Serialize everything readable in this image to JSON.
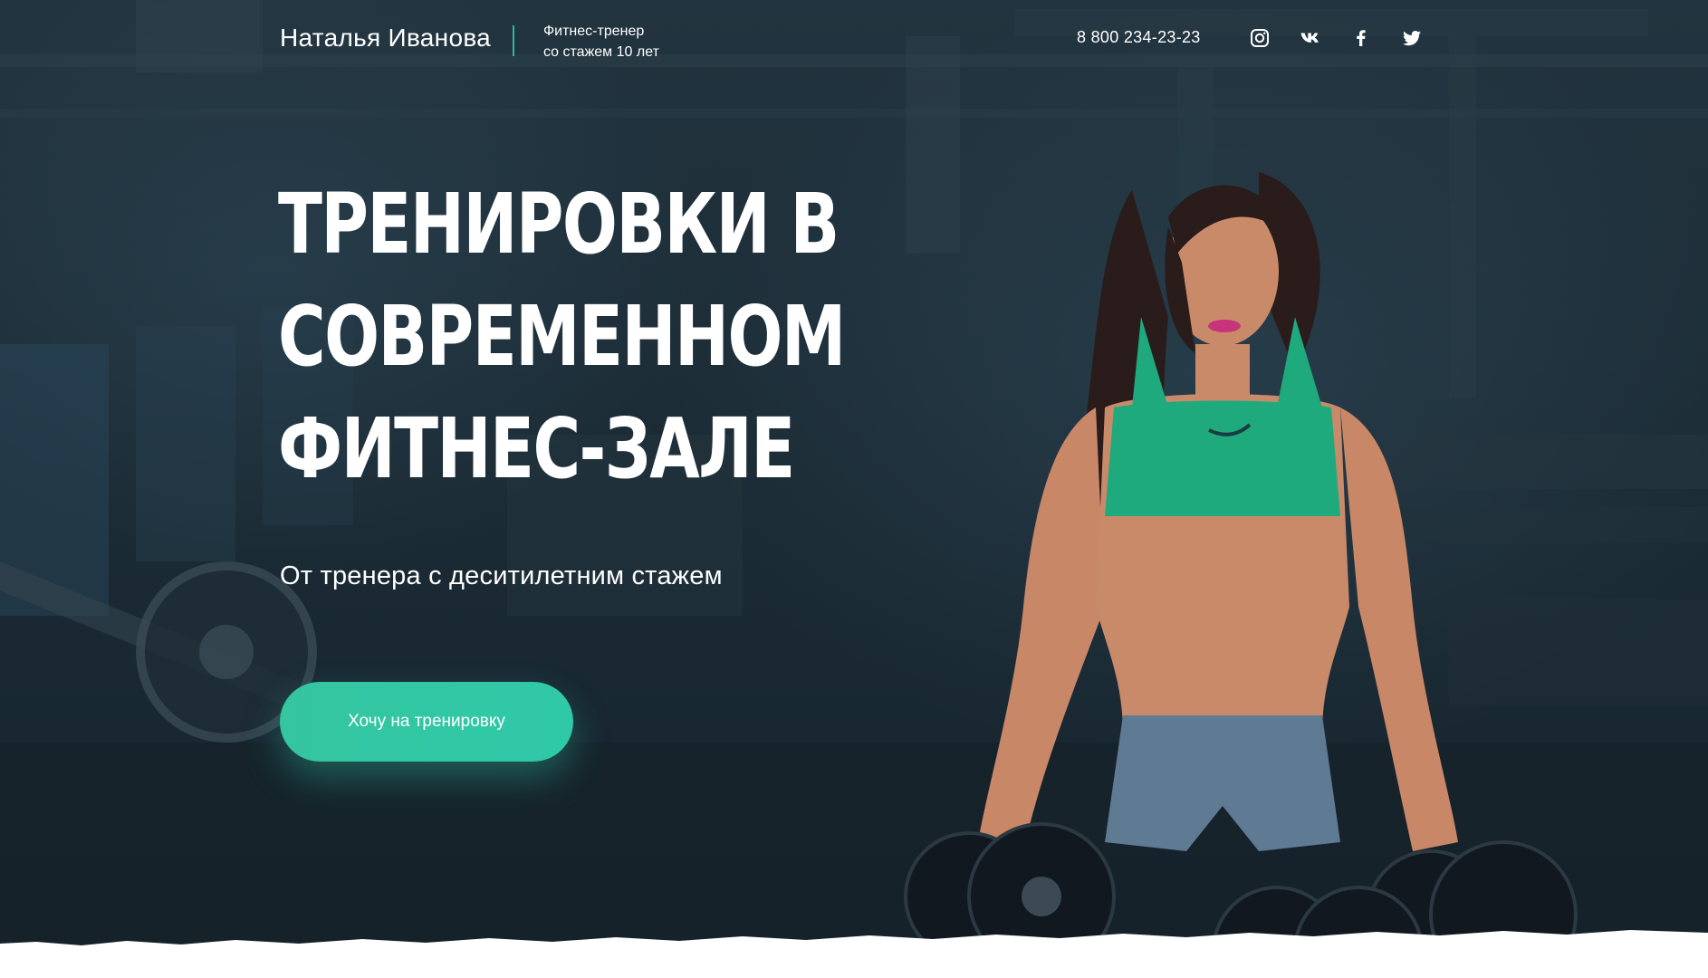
{
  "header": {
    "brand_name": "Наталья Иванова",
    "tagline_line1": "Фитнес-тренер",
    "tagline_line2": "со стажем 10 лет",
    "phone": "8 800 234-23-23",
    "socials": [
      {
        "name": "instagram",
        "icon": "instagram-icon"
      },
      {
        "name": "vk",
        "icon": "vk-icon"
      },
      {
        "name": "facebook",
        "icon": "facebook-icon"
      },
      {
        "name": "twitter",
        "icon": "twitter-icon"
      }
    ]
  },
  "hero": {
    "headline_line1": "Тренировки в",
    "headline_line2": "современном",
    "headline_line3": "фитнес-зале",
    "subtitle": "От тренера с деситилетним стажем",
    "cta_label": "Хочу на тренировку"
  },
  "colors": {
    "accent": "#2fc9a8",
    "background": "#1b2b35",
    "text": "#ffffff"
  }
}
